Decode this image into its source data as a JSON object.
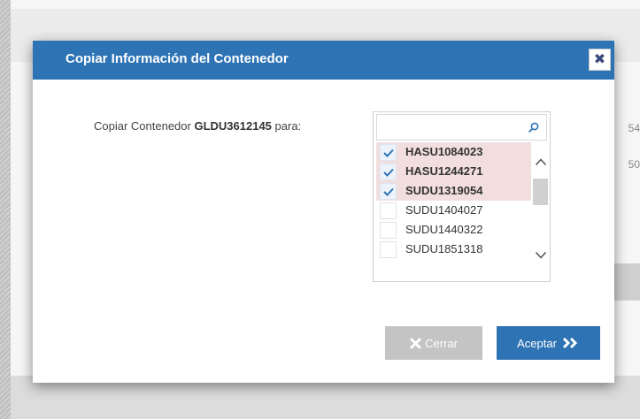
{
  "background": {
    "row_values": [
      "54",
      "50"
    ]
  },
  "modal": {
    "title": "Copiar Información del Contenedor",
    "close_icon": "close-icon",
    "copy_label_prefix": "Copiar Contenedor ",
    "container_id": "GLDU3612145",
    "copy_label_suffix": " para:",
    "search": {
      "value": "",
      "placeholder": "",
      "icon": "search-icon"
    },
    "items": [
      {
        "label": "HASU1084023",
        "checked": true
      },
      {
        "label": "HASU1244271",
        "checked": true
      },
      {
        "label": "SUDU1319054",
        "checked": true
      },
      {
        "label": "SUDU1404027",
        "checked": false
      },
      {
        "label": "SUDU1440322",
        "checked": false
      },
      {
        "label": "SUDU1851318",
        "checked": false
      }
    ],
    "buttons": {
      "cancel_label": "Cerrar",
      "accept_label": "Aceptar"
    }
  },
  "colors": {
    "header": "#2e74b5",
    "accept_button": "#2e74b5",
    "cancel_button": "#c4c4c4",
    "checked_row": "#f2dede"
  }
}
